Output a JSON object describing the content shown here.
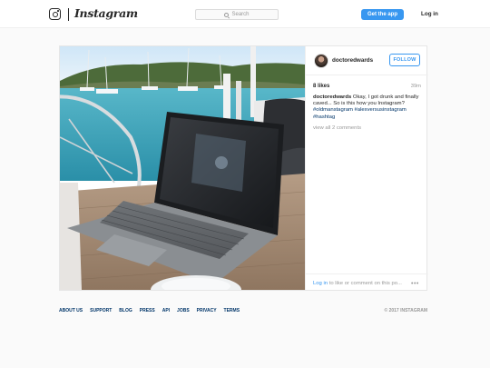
{
  "nav": {
    "logo_text": "Instagram",
    "search_placeholder": "Search",
    "get_app_label": "Get the app",
    "login_label": "Log in"
  },
  "post": {
    "username": "doctoredwards",
    "follow_label": "FOLLOW",
    "likes": "8 likes",
    "time": "39m",
    "caption_user": "doctoredwards",
    "caption_text": "Okay, I got drunk and finally caved... So is this how you Instagram?",
    "caption_tags": "#oldmanstagram #alexversusinstagram #hashtag",
    "view_comments": "view all 2 comments",
    "login_link": "Log in",
    "login_rest": " to like or comment on this po...",
    "more_icon": "more-options-icon"
  },
  "footer": {
    "links": [
      "ABOUT US",
      "SUPPORT",
      "BLOG",
      "PRESS",
      "API",
      "JOBS",
      "PRIVACY",
      "TERMS"
    ],
    "copyright": "© 2017 INSTAGRAM"
  },
  "colors": {
    "accent": "#3897f0",
    "link_dark": "#003569",
    "muted": "#999999"
  }
}
